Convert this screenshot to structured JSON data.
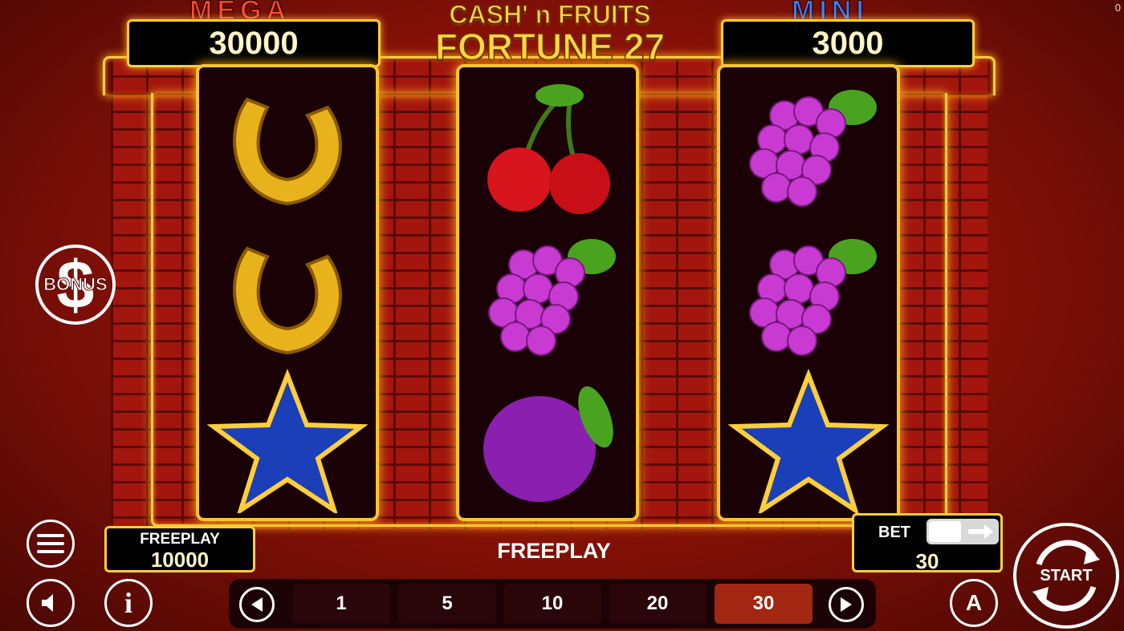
{
  "corner_counter": "0",
  "title": {
    "line1": "CASH' n FRUITS",
    "line2": "FORTUNE 27"
  },
  "jackpots": {
    "mega": {
      "label": "MEGA",
      "value": "30000"
    },
    "mini": {
      "label": "MINI",
      "value": "3000"
    }
  },
  "bonus_button": {
    "label": "BONUS",
    "icon": "dollar-icon"
  },
  "reels": [
    [
      "horseshoe",
      "horseshoe",
      "blue-star"
    ],
    [
      "cherry",
      "grapes",
      "plum"
    ],
    [
      "grapes",
      "grapes",
      "blue-star"
    ]
  ],
  "freeplay_panel": {
    "label": "FREEPLAY",
    "value": "10000"
  },
  "status_text": "FREEPLAY",
  "bet_panel": {
    "label": "BET",
    "value": "30"
  },
  "bet_options": [
    "1",
    "5",
    "10",
    "20",
    "30"
  ],
  "selected_bet": "30",
  "start_button": {
    "label": "START"
  },
  "colors": {
    "gold": "#ffcf3a",
    "background": "#8e1208",
    "selected_bet": "#a32612"
  }
}
